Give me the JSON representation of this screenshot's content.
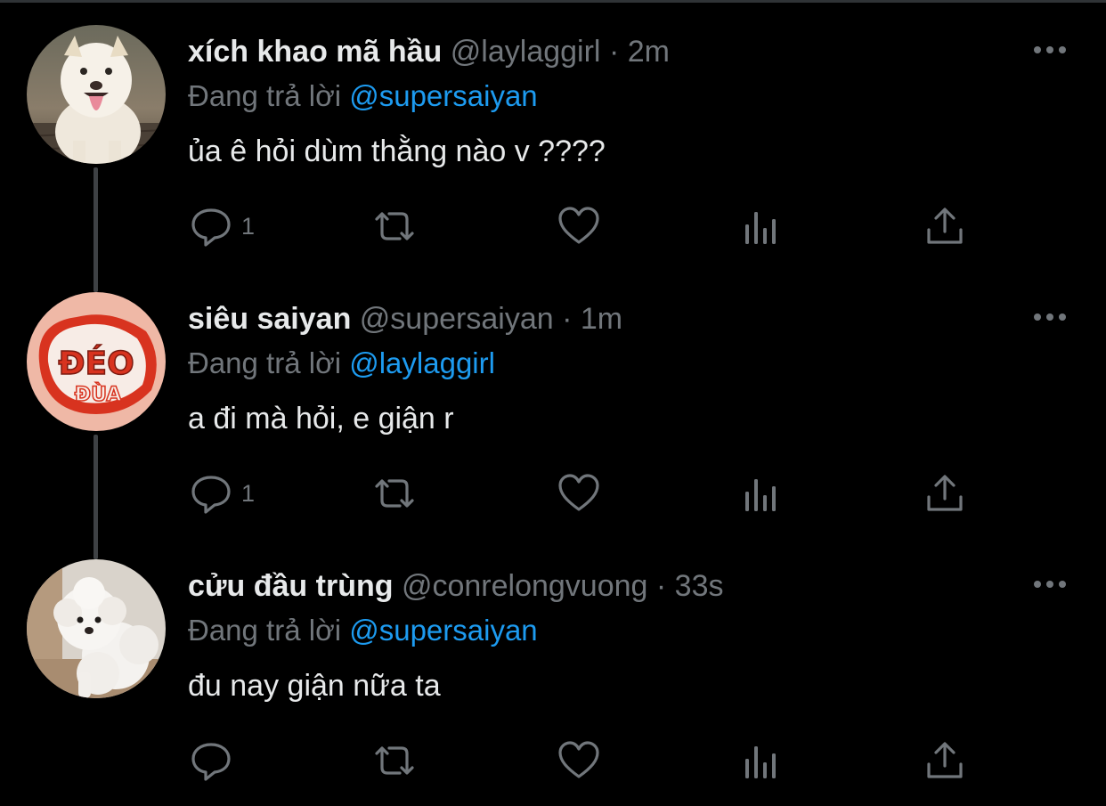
{
  "theme": {
    "background": "#000000",
    "text": "#e7e9ea",
    "secondary": "#71767b",
    "mention": "#1d9bf0",
    "thread_line": "#3e4144"
  },
  "replying_prefix": "Đang trả lời",
  "tweets": [
    {
      "name": "xích khao mã hầu",
      "handle": "@laylaggirl",
      "separator": "·",
      "time": "2m",
      "reply_to": "@supersaiyan",
      "text": "ủa ê hỏi dùm thằng nào v ????",
      "reply_count": "1",
      "avatar": "dog-avatar"
    },
    {
      "name": "siêu saiyan",
      "handle": "@supersaiyan",
      "separator": "·",
      "time": "1m",
      "reply_to": "@laylaggirl",
      "text": "a đi mà hỏi, e giận r",
      "reply_count": "1",
      "avatar": "sticker-avatar",
      "avatar_text": "ĐÉO ĐÙA"
    },
    {
      "name": "cửu đầu trùng",
      "handle": "@conrelongvuong",
      "separator": "·",
      "time": "33s",
      "reply_to": "@supersaiyan",
      "text": "đu nay giận nữa ta",
      "reply_count": "",
      "avatar": "poodle-avatar"
    }
  ],
  "icons": [
    "reply-icon",
    "retweet-icon",
    "like-icon",
    "analytics-icon",
    "share-icon",
    "more-icon"
  ]
}
